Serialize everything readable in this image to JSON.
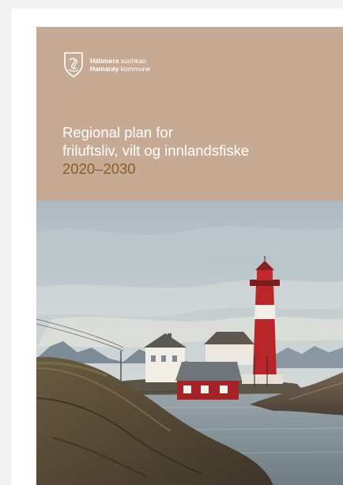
{
  "logo": {
    "line1_bold": "Hábmera",
    "line1_rest": "suohkan",
    "line2_bold": "Hamarøy",
    "line2_rest": "kommune",
    "icon": "municipal-shield-icon"
  },
  "title": {
    "line1": "Regional plan for",
    "line2": "friluftsliv, vilt og innlandsfiske",
    "years": "2020–2030"
  },
  "photo": {
    "subject": "lighthouse-coastal-landscape"
  },
  "colors": {
    "header_bg": "#c7aa93",
    "title_text": "#ffffff",
    "years_text": "#8c5a2b",
    "lighthouse_red": "#b8262a"
  }
}
